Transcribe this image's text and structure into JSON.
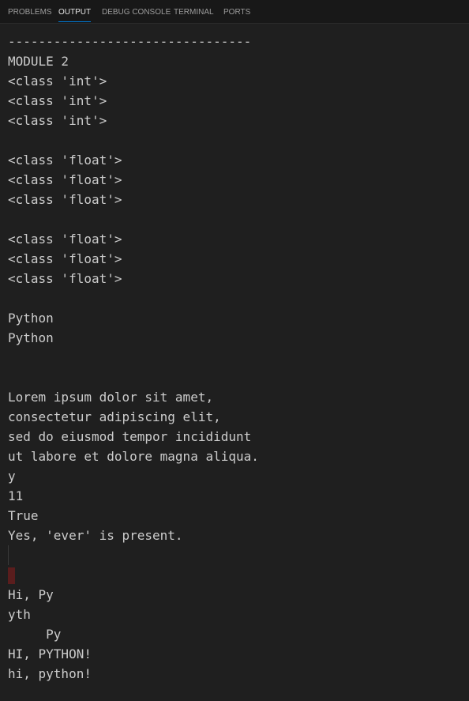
{
  "panel": {
    "tabs": [
      {
        "label": "PROBLEMS"
      },
      {
        "label": "OUTPUT"
      },
      {
        "label": "DEBUG CONSOLE"
      },
      {
        "label": "TERMINAL"
      },
      {
        "label": "PORTS"
      }
    ],
    "active_tab": "OUTPUT",
    "accent_color": "#0078d4"
  },
  "output": {
    "lines": [
      "--------------------------------",
      "MODULE 2",
      "<class 'int'>",
      "<class 'int'>",
      "<class 'int'>",
      "",
      "<class 'float'>",
      "<class 'float'>",
      "<class 'float'>",
      "",
      "<class 'float'>",
      "<class 'float'>",
      "<class 'float'>",
      "",
      "Python",
      "Python",
      "",
      "",
      "Lorem ipsum dolor sit amet,",
      "consectetur adipiscing elit,",
      "sed do eiusmod tempor incididunt",
      "ut labore et dolore magna aliqua.",
      "y",
      "11",
      "True",
      "Yes, 'ever' is present.",
      "",
      " Py",
      "Hi, Py",
      "yth",
      "",
      "HI, PYTHON!",
      "hi, python!"
    ]
  }
}
